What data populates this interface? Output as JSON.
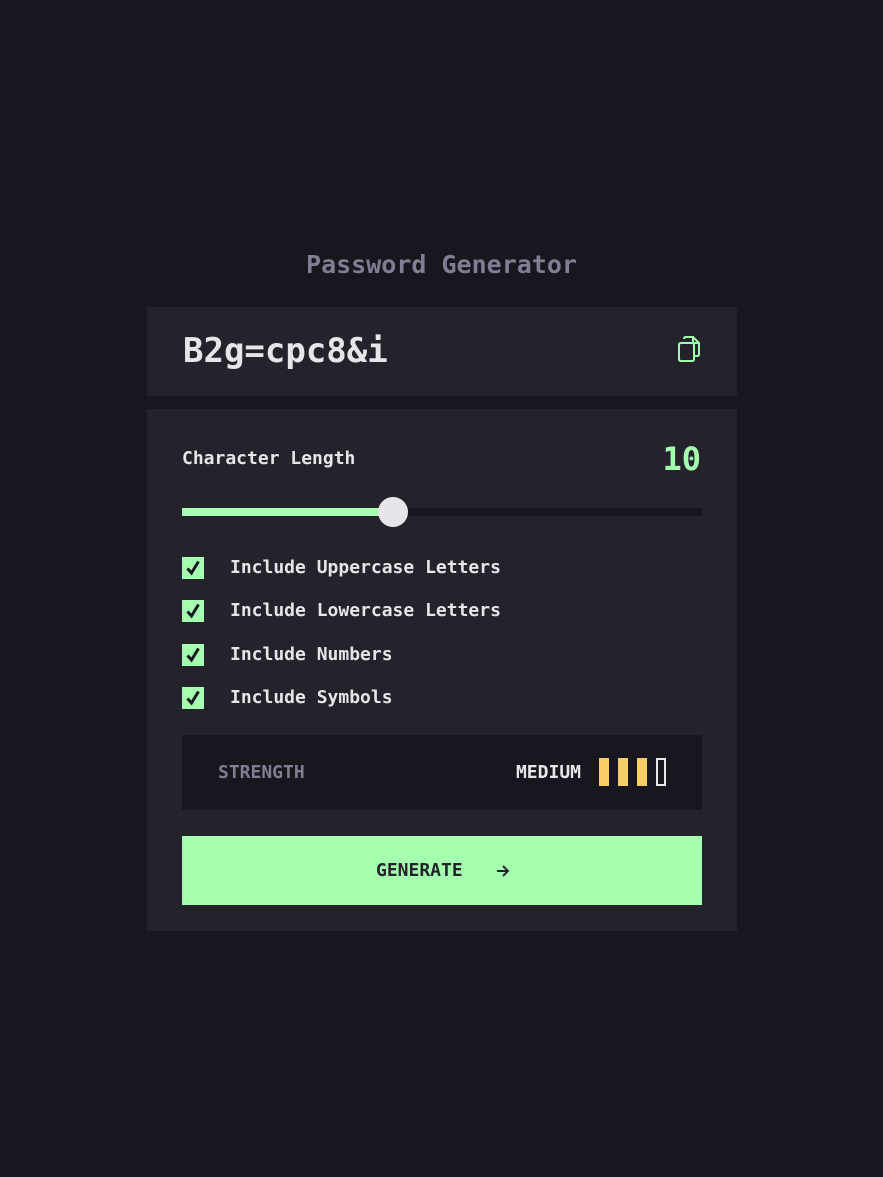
{
  "app": {
    "title": "Password Generator"
  },
  "password": {
    "value": "B2g=cpc8&i",
    "copy_icon": "copy-icon"
  },
  "length": {
    "label": "Character Length",
    "value": "10",
    "slider_fraction": 0.405
  },
  "options": [
    {
      "label": "Include Uppercase Letters",
      "checked": true
    },
    {
      "label": "Include Lowercase Letters",
      "checked": true
    },
    {
      "label": "Include Numbers",
      "checked": true
    },
    {
      "label": "Include Symbols",
      "checked": true
    }
  ],
  "strength": {
    "label": "STRENGTH",
    "value": "MEDIUM",
    "level": 3,
    "max_level": 4
  },
  "generate": {
    "label": "GENERATE",
    "icon": "arrow-right-icon"
  },
  "colors": {
    "accent": "#a4ffaf",
    "medium": "#f8cd65",
    "background": "#18171f",
    "panel": "#24232c",
    "muted": "#817d92",
    "text": "#e6e5ea"
  }
}
